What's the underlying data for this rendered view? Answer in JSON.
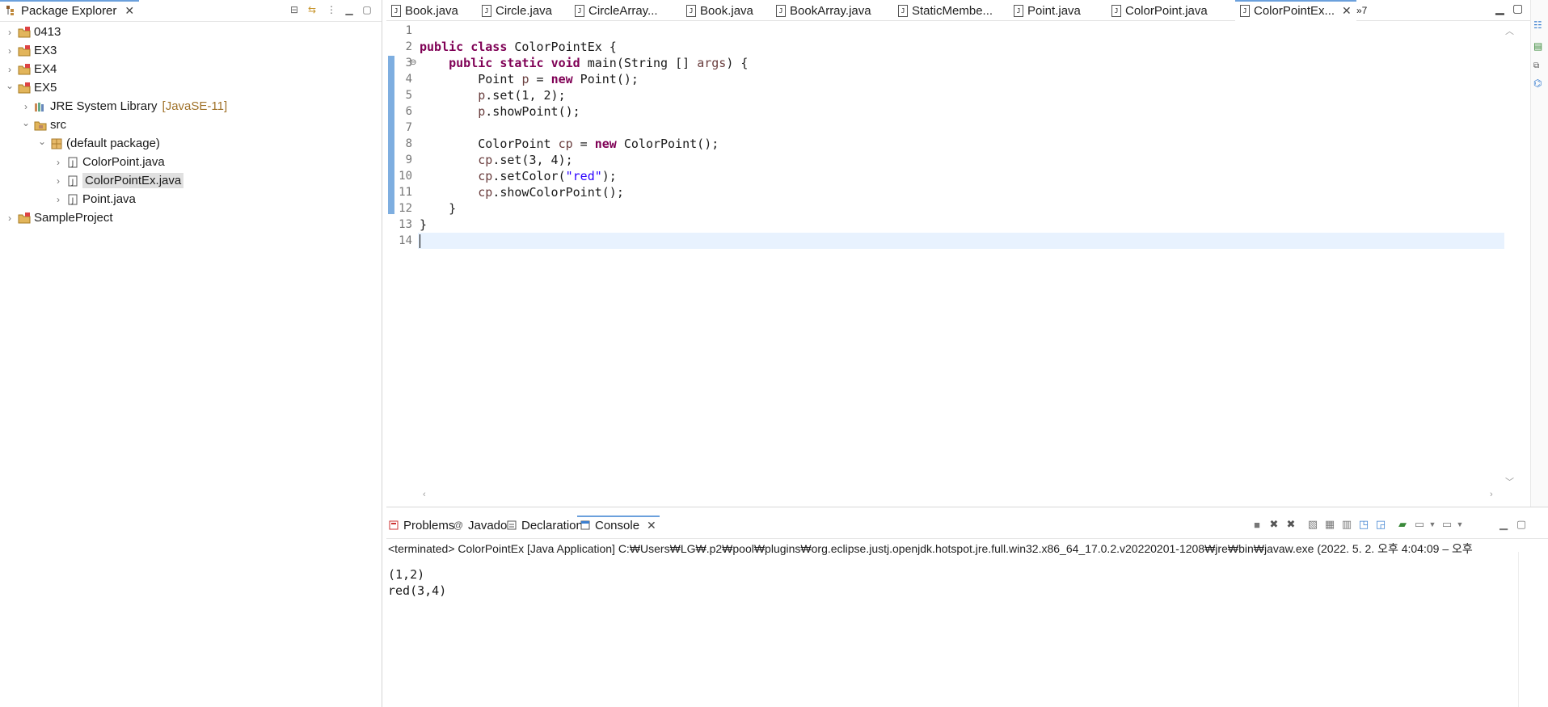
{
  "explorer": {
    "title": "Package Explorer",
    "tree": [
      {
        "label": "0413",
        "kind": "project",
        "depth": 0,
        "toggle": "collapsed"
      },
      {
        "label": "EX3",
        "kind": "project",
        "depth": 0,
        "toggle": "collapsed"
      },
      {
        "label": "EX4",
        "kind": "project",
        "depth": 0,
        "toggle": "collapsed"
      },
      {
        "label": "EX5",
        "kind": "project",
        "depth": 0,
        "toggle": "expanded"
      },
      {
        "label": "JRE System Library",
        "extra": "[JavaSE-11]",
        "kind": "library",
        "depth": 1,
        "toggle": "collapsed"
      },
      {
        "label": "src",
        "kind": "src",
        "depth": 1,
        "toggle": "expanded"
      },
      {
        "label": "(default package)",
        "kind": "package",
        "depth": 2,
        "toggle": "expanded"
      },
      {
        "label": "ColorPoint.java",
        "kind": "java",
        "depth": 3,
        "toggle": "collapsed"
      },
      {
        "label": "ColorPointEx.java",
        "kind": "java",
        "depth": 3,
        "toggle": "collapsed",
        "selected": true
      },
      {
        "label": "Point.java",
        "kind": "java",
        "depth": 3,
        "toggle": "collapsed"
      },
      {
        "label": "SampleProject",
        "kind": "project",
        "depth": 0,
        "toggle": "collapsed"
      }
    ]
  },
  "editor": {
    "tabs": [
      "Book.java",
      "Circle.java",
      "CircleArray...",
      "Book.java",
      "BookArray.java",
      "StaticMembe...",
      "Point.java",
      "ColorPoint.java",
      "ColorPointEx..."
    ],
    "active_tab": "ColorPointEx...",
    "overflow": "»7",
    "line_numbers": [
      "1",
      "2",
      "3",
      "4",
      "5",
      "6",
      "7",
      "8",
      "9",
      "10",
      "11",
      "12",
      "13",
      "14"
    ],
    "code_lines": [
      "",
      "public class ColorPointEx {",
      "    public static void main(String [] args) {",
      "        Point p = new Point();",
      "        p.set(1, 2);",
      "        p.showPoint();",
      "",
      "        ColorPoint cp = new ColorPoint();",
      "        cp.set(3, 4);",
      "        cp.setColor(\"red\");",
      "        cp.showColorPoint();",
      "    }",
      "}",
      ""
    ]
  },
  "console": {
    "tabs": [
      "Problems",
      "Javadoc",
      "Declaration",
      "Console"
    ],
    "active_tab": "Console",
    "terminated": "<terminated> ColorPointEx [Java Application] C:₩Users₩LG₩.p2₩pool₩plugins₩org.eclipse.justj.openjdk.hotspot.jre.full.win32.x86_64_17.0.2.v20220201-1208₩jre₩bin₩javaw.exe  (2022. 5. 2. 오후 4:04:09 – 오후",
    "output": [
      "(1,2)",
      "red(3,4)"
    ]
  },
  "colors": {
    "keyword": "#7f0055",
    "variable": "#6a3e3e",
    "string": "#2a00ff",
    "current_line": "#e8f2fe",
    "selection_tab": "#6ba0dc"
  }
}
